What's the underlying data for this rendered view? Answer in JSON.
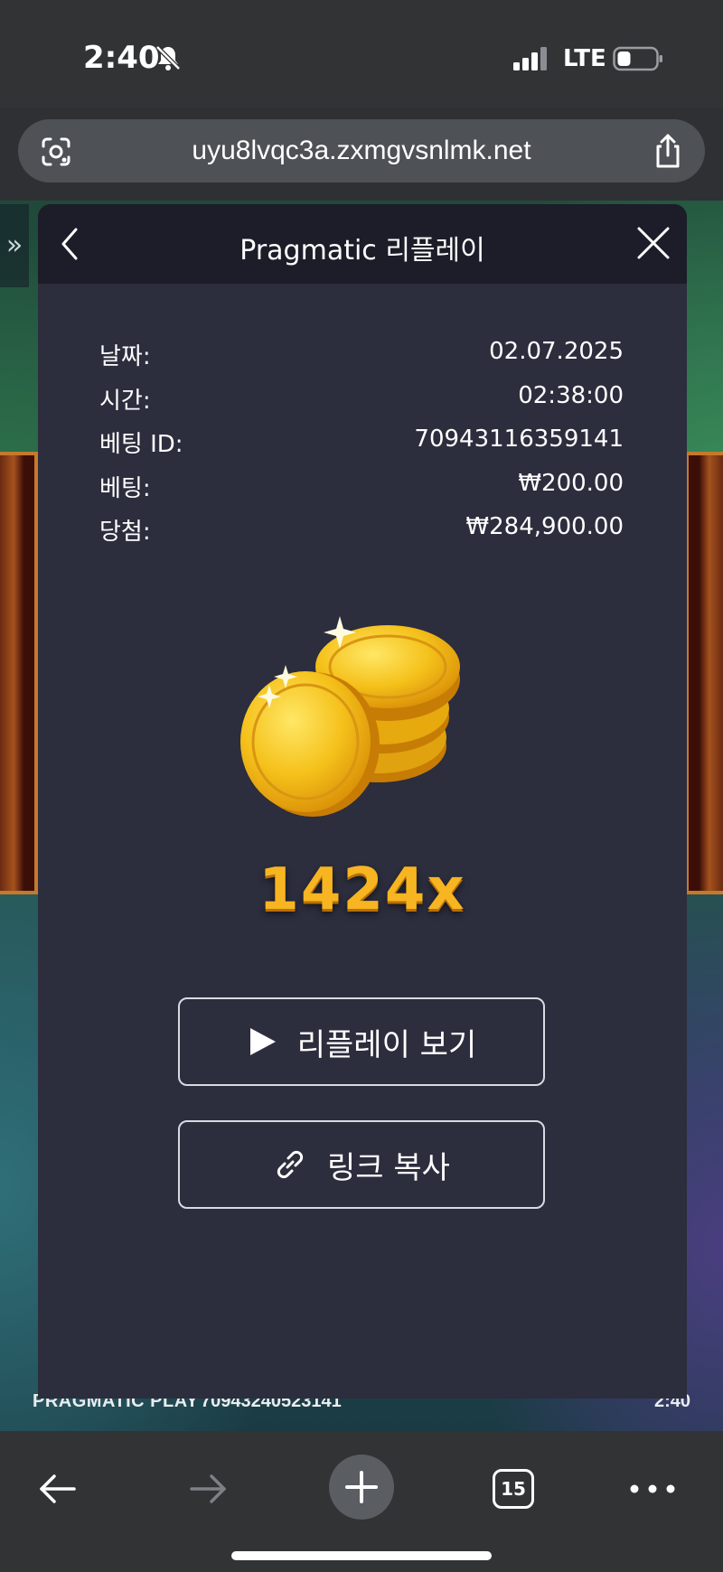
{
  "status_bar": {
    "time": "2:40",
    "network": "LTE"
  },
  "browser": {
    "url": "uyu8lvqc3a.zxmgvsnlmk.net",
    "tab_count": "15"
  },
  "game_footer": {
    "provider": "PRAGMATIC PLAY",
    "round_id": "70943240523141",
    "clock": "2:40"
  },
  "modal": {
    "title": "Pragmatic 리플레이",
    "info": [
      {
        "label": "날짜:",
        "value": "02.07.2025"
      },
      {
        "label": "시간:",
        "value": "02:38:00"
      },
      {
        "label": "베팅 ID:",
        "value": "70943116359141"
      },
      {
        "label": "베팅:",
        "value": "₩200.00"
      },
      {
        "label": "당첨:",
        "value": "₩284,900.00"
      }
    ],
    "multiplier": "1424x",
    "replay_button": "리플레이 보기",
    "copy_link_button": "링크 복사"
  },
  "icons": {
    "silent_bell": "bell-slash-icon",
    "signal": "signal-bars-icon",
    "battery": "battery-icon",
    "lens": "google-lens-icon",
    "share": "share-icon",
    "back": "chevron-left-icon",
    "close": "close-icon",
    "play": "play-icon",
    "link": "link-icon",
    "coins": "gold-coins-illustration",
    "nav_back": "arrow-left-icon",
    "nav_forward": "arrow-right-icon",
    "new_tab": "plus-icon",
    "more": "more-dots-icon"
  },
  "colors": {
    "modal_bg": "#2c2d3d",
    "modal_header_bg": "#1c1d28",
    "multiplier_gold": "#f7b521",
    "browser_chrome": "#313335"
  }
}
